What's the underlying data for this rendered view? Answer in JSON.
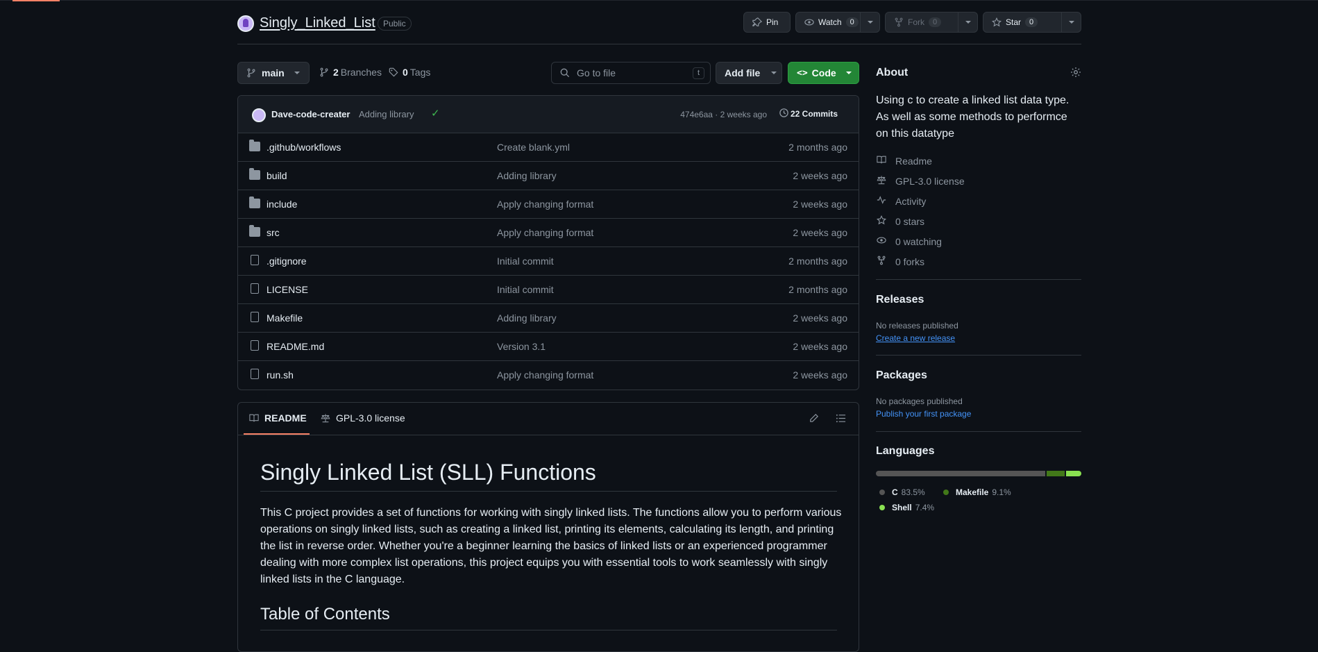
{
  "repo": {
    "name": "Singly_Linked_List",
    "visibility": "Public"
  },
  "header_buttons": {
    "pin": "Pin",
    "watch": "Watch",
    "watch_count": "0",
    "fork": "Fork",
    "fork_count": "0",
    "star": "Star",
    "star_count": "0"
  },
  "toolbar": {
    "branch": "main",
    "branches_count": "2",
    "branches_label": "Branches",
    "tags_count": "0",
    "tags_label": "Tags",
    "search_placeholder": "Go to file",
    "search_key": "t",
    "add_file": "Add file",
    "code": "Code"
  },
  "latest_commit": {
    "author": "Dave-code-creater",
    "message": "Adding library",
    "meta": "474e6aa · 2 weeks ago",
    "commits_label": "22 Commits"
  },
  "files": [
    {
      "name": ".github/workflows",
      "type": "folder",
      "message": "Create blank.yml",
      "date": "2 months ago"
    },
    {
      "name": "build",
      "type": "folder",
      "message": "Adding library",
      "date": "2 weeks ago"
    },
    {
      "name": "include",
      "type": "folder",
      "message": "Apply changing format",
      "date": "2 weeks ago"
    },
    {
      "name": "src",
      "type": "folder",
      "message": "Apply changing format",
      "date": "2 weeks ago"
    },
    {
      "name": ".gitignore",
      "type": "file",
      "message": "Initial commit",
      "date": "2 months ago"
    },
    {
      "name": "LICENSE",
      "type": "file",
      "message": "Initial commit",
      "date": "2 months ago"
    },
    {
      "name": "Makefile",
      "type": "file",
      "message": "Adding library",
      "date": "2 weeks ago"
    },
    {
      "name": "README.md",
      "type": "file",
      "message": "Version 3.1",
      "date": "2 weeks ago"
    },
    {
      "name": "run.sh",
      "type": "file",
      "message": "Apply changing format",
      "date": "2 weeks ago"
    }
  ],
  "readme": {
    "tab_readme": "README",
    "tab_license": "GPL-3.0 license",
    "title": "Singly Linked List (SLL) Functions",
    "paragraph": "This C project provides a set of functions for working with singly linked lists. The functions allow you to perform various operations on singly linked lists, such as creating a linked list, printing its elements, calculating its length, and printing the list in reverse order. Whether you're a beginner learning the basics of linked lists or an experienced programmer dealing with more complex list operations, this project equips you with essential tools to work seamlessly with singly linked lists in the C language.",
    "toc_title": "Table of Contents"
  },
  "about": {
    "title": "About",
    "description": "Using c to create a linked list data type. As well as some methods to performce on this datatype",
    "readme": "Readme",
    "license": "GPL-3.0 license",
    "activity": "Activity",
    "stars": "0 stars",
    "watching": "0 watching",
    "forks": "0 forks"
  },
  "releases": {
    "title": "Releases",
    "none": "No releases published",
    "create": "Create a new release"
  },
  "packages": {
    "title": "Packages",
    "none": "No packages published",
    "publish": "Publish your first package"
  },
  "languages": {
    "title": "Languages",
    "items": [
      {
        "name": "C",
        "percent": "83.5%",
        "value": 83.5,
        "color": "#555555"
      },
      {
        "name": "Makefile",
        "percent": "9.1%",
        "value": 9.1,
        "color": "#427819"
      },
      {
        "name": "Shell",
        "percent": "7.4%",
        "value": 7.4,
        "color": "#89e051"
      }
    ]
  },
  "colors": {
    "accent": "#f78166",
    "primary_button": "#238636",
    "link": "#4493f8"
  }
}
